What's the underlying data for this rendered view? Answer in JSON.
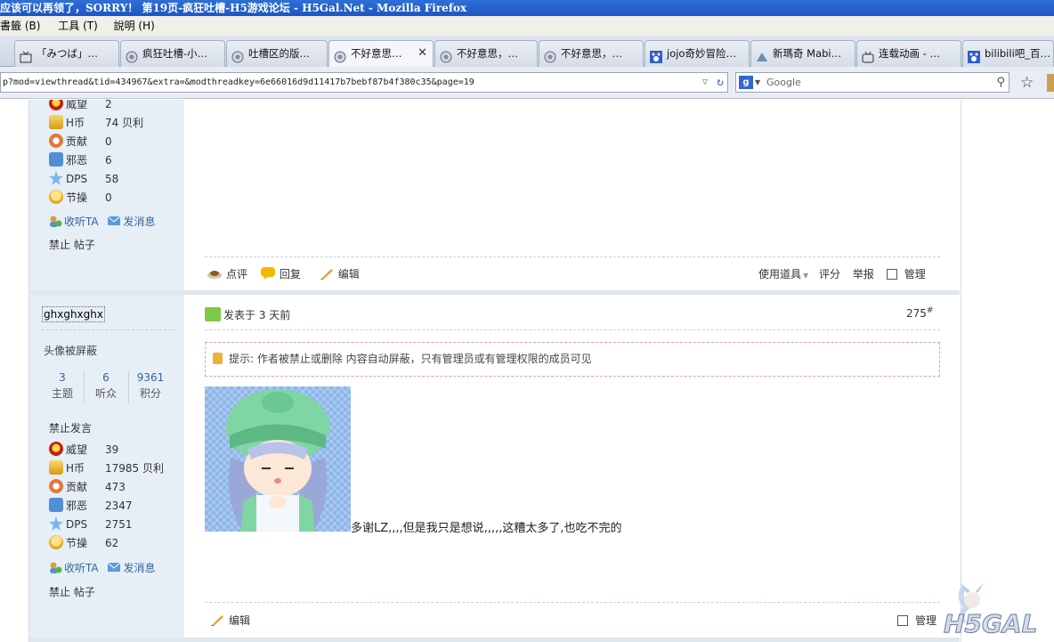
{
  "window": {
    "title": "应该可以再领了，SORRY！ 第19页-疯狂吐槽-H5游戏论坛 - H5Gal.Net - Mozilla Firefox"
  },
  "menu": {
    "items": [
      "書籤 (B)",
      "工具 (T)",
      "說明 (H)"
    ]
  },
  "tabs": [
    {
      "label": "「みつば」…",
      "icon": "tv-icon"
    },
    {
      "label": "疯狂吐槽-小…",
      "icon": "h5gal-icon"
    },
    {
      "label": "吐槽区的版…",
      "icon": "h5gal-icon"
    },
    {
      "label": "不好意思…",
      "icon": "h5gal-icon",
      "active": true
    },
    {
      "label": "不好意思，…",
      "icon": "h5gal-icon"
    },
    {
      "label": "不好意思，…",
      "icon": "h5gal-icon"
    },
    {
      "label": "jojo奇妙冒险…",
      "icon": "baidu-paw-icon"
    },
    {
      "label": "新瑪奇 Mabi…",
      "icon": "mabinogi-icon"
    },
    {
      "label": "连载动画 - …",
      "icon": "bilibili-tv-icon"
    },
    {
      "label": "bilibili吧_百…",
      "icon": "baidu-paw-icon"
    }
  ],
  "nav": {
    "url": "p?mod=viewthread&tid=434967&extra=&modthreadkey=6e66016d9d11417b7bebf87b4f380c35&page=19",
    "search_engine": "Google",
    "search_placeholder": "Google"
  },
  "prev_user": {
    "stats": [
      {
        "icon": "crown-icon",
        "name": "威望",
        "value": "2"
      },
      {
        "icon": "coin-stack-icon",
        "name": "H币",
        "value": "74 贝利"
      },
      {
        "icon": "heart-ring-icon",
        "name": "贡献",
        "value": "0"
      },
      {
        "icon": "puzzle-icon",
        "name": "邪恶",
        "value": "6"
      },
      {
        "icon": "star-icon",
        "name": "DPS",
        "value": "58"
      },
      {
        "icon": "bulb-icon",
        "name": "节操",
        "value": "0"
      }
    ],
    "follow_label": "收听TA",
    "message_label": "发消息",
    "ban_label": "禁止 帖子"
  },
  "prev_actions": {
    "comment": "点评",
    "reply": "回复",
    "edit": "编辑",
    "use_item": "使用道具",
    "rate": "评分",
    "report": "举报",
    "manage": "管理"
  },
  "post": {
    "username": "ghxghxghx",
    "avatar_note": "头像被屏蔽",
    "counts": [
      {
        "value": "3",
        "label": "主题"
      },
      {
        "value": "6",
        "label": "听众"
      },
      {
        "value": "9361",
        "label": "积分"
      }
    ],
    "status": "禁止发言",
    "stats": [
      {
        "icon": "crown-icon",
        "name": "威望",
        "value": "39"
      },
      {
        "icon": "coin-stack-icon",
        "name": "H币",
        "value": "17985 贝利"
      },
      {
        "icon": "heart-ring-icon",
        "name": "贡献",
        "value": "473"
      },
      {
        "icon": "puzzle-icon",
        "name": "邪恶",
        "value": "2347"
      },
      {
        "icon": "star-icon",
        "name": "DPS",
        "value": "2751"
      },
      {
        "icon": "bulb-icon",
        "name": "节操",
        "value": "62"
      }
    ],
    "follow_label": "收听TA",
    "message_label": "发消息",
    "ban_label": "禁止 帖子",
    "posted": "发表于 3 天前",
    "floor": "275",
    "floor_mark": "#",
    "notice": "提示: 作者被禁止或删除 内容自动屏蔽，只有管理员或有管理权限的成员可见",
    "body_text": "多谢LZ,,,,但是我只是想说,,,,,这糟太多了,也吃不完的",
    "edit_label": "编辑",
    "manage_label": "管理"
  },
  "logo": {
    "text": "H5GAL"
  },
  "colors": {
    "link": "#336699",
    "sidebar_bg": "#e6eef6",
    "title_bar": "#1c56c4"
  }
}
